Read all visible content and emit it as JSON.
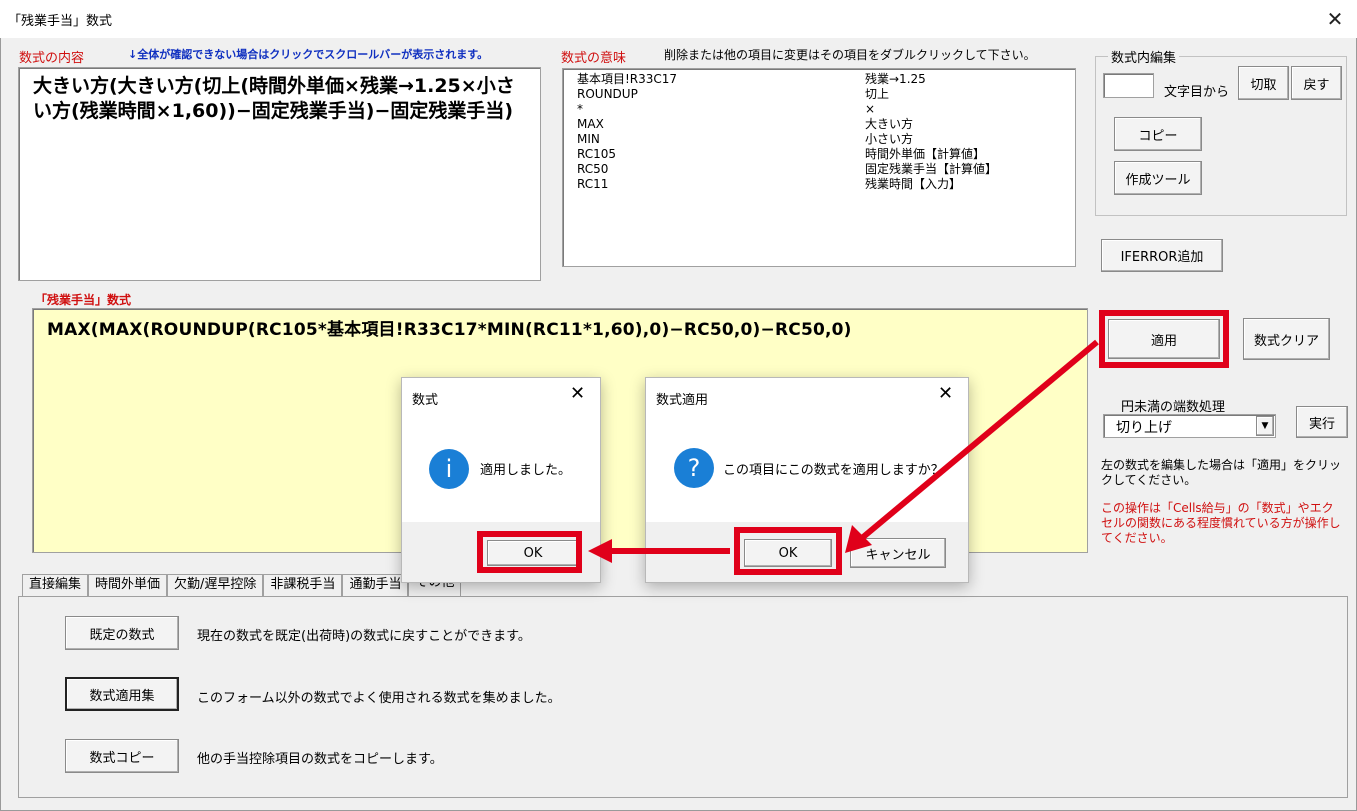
{
  "window": {
    "title": "「残業手当」数式",
    "close": "✕"
  },
  "left": {
    "label": "数式の内容",
    "hint": "↓全体が確認できない場合はクリックでスクロールバーが表示されます。",
    "content": "大きい方(大きい方(切上(時間外単価×残業→1.25×小さい方(残業時間×1,60))−固定残業手当)−固定残業手当)"
  },
  "meaning": {
    "label": "数式の意味",
    "hint": "削除または他の項目に変更はその項目をダブルクリックして下さい。",
    "rows": [
      {
        "key": "基本項目!R33C17",
        "value": "残業→1.25"
      },
      {
        "key": "ROUNDUP",
        "value": "切上"
      },
      {
        "key": "*",
        "value": "×"
      },
      {
        "key": "MAX",
        "value": "大きい方"
      },
      {
        "key": "MIN",
        "value": "小さい方"
      },
      {
        "key": "RC105",
        "value": "時間外単価【計算値】"
      },
      {
        "key": "RC50",
        "value": "固定残業手当【計算値】"
      },
      {
        "key": "RC11",
        "value": "残業時間【入力】"
      }
    ]
  },
  "edit_group": {
    "legend": "数式内編集",
    "char_from": "文字目から",
    "cut": "切取",
    "undo": "戻す",
    "copy": "コピー",
    "tool": "作成ツール"
  },
  "iferror": "IFERROR追加",
  "formula": {
    "label": "「残業手当」数式",
    "text": "MAX(MAX(ROUNDUP(RC105*基本項目!R33C17*MIN(RC11*1,60),0)−RC50,0)−RC50,0)"
  },
  "apply": "適用",
  "clear": "数式クリア",
  "rounding": {
    "label": "円未満の端数処理",
    "selected": "切り上げ",
    "exec": "実行"
  },
  "note1": "左の数式を編集した場合は「適用」をクリックしてください。",
  "note2": "この操作は「Cells給与」の「数式」やエクセルの関数にある程度慣れている方が操作してください。",
  "tabs": [
    "直接編集",
    "時間外単価",
    "欠勤/遅早控除",
    "非課税手当",
    "通勤手当",
    "その他"
  ],
  "bottom": {
    "rows": [
      {
        "button": "既定の数式",
        "desc": "現在の数式を既定(出荷時)の数式に戻すことができます。"
      },
      {
        "button": "数式適用集",
        "desc": "このフォーム以外の数式でよく使用される数式を集めました。"
      },
      {
        "button": "数式コピー",
        "desc": "他の手当控除項目の数式をコピーします。"
      }
    ]
  },
  "dialog1": {
    "title": "数式",
    "message": "適用しました。",
    "ok": "OK",
    "icon": "i"
  },
  "dialog2": {
    "title": "数式適用",
    "message": "この項目にこの数式を適用しますか？",
    "ok": "OK",
    "cancel": "キャンセル",
    "icon": "?"
  },
  "colors": {
    "accent_red": "#e0001a",
    "formula_bg": "#ffffc6",
    "info_blue": "#1a7fd6"
  }
}
